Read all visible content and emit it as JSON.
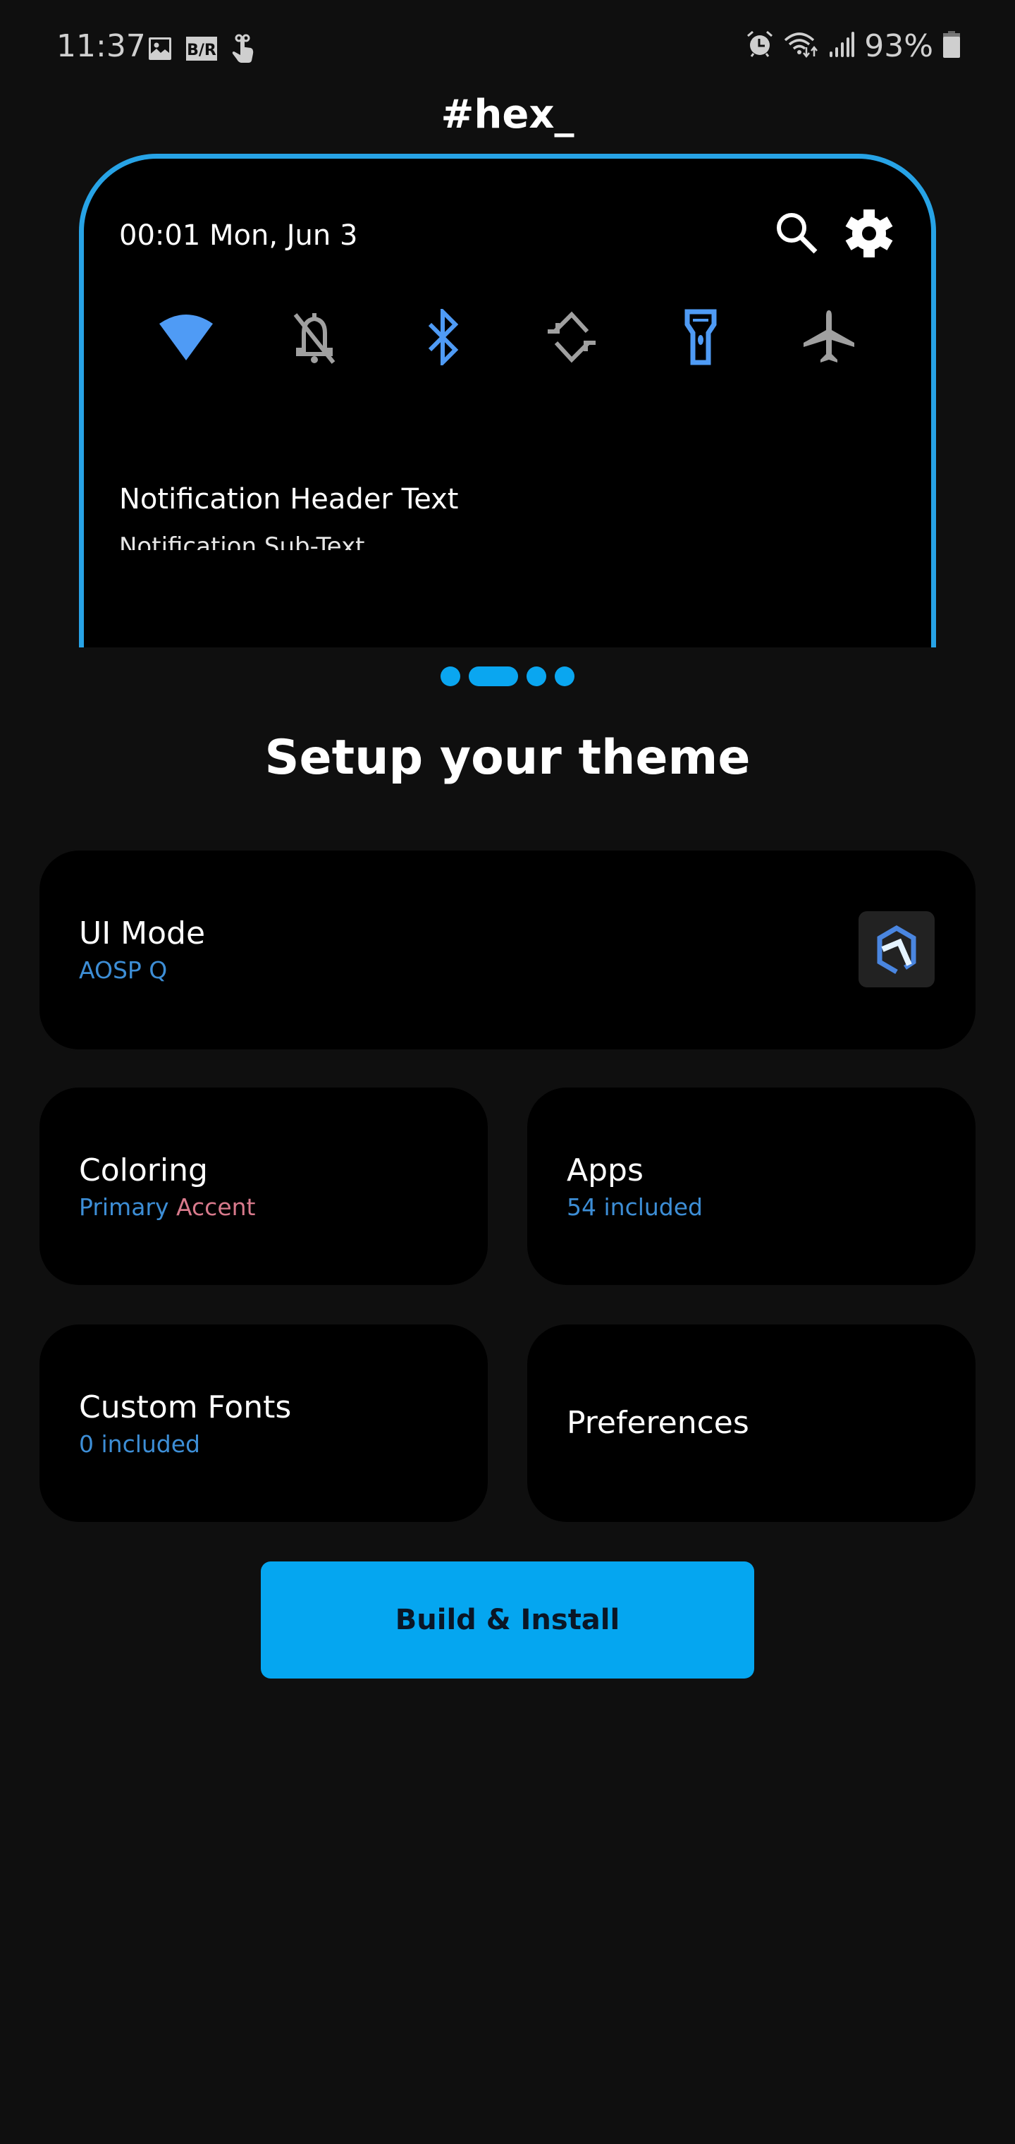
{
  "status_bar": {
    "time": "11:37",
    "left_icons": [
      "gallery-icon",
      "bleacher-report-icon",
      "touch-gesture-icon"
    ],
    "right_icons": [
      "alarm-icon",
      "wifi-data-icon",
      "cell-signal-icon",
      "battery-icon"
    ],
    "battery_percent": "93%",
    "br_label": "B/R"
  },
  "app": {
    "title": "#hex_"
  },
  "preview": {
    "datetime": "00:01 Mon, Jun 3",
    "actions": [
      "search-icon",
      "settings-icon"
    ],
    "quick_settings": [
      {
        "name": "wifi",
        "active": true
      },
      {
        "name": "do-not-disturb-off",
        "active": false
      },
      {
        "name": "bluetooth",
        "active": true
      },
      {
        "name": "auto-rotate",
        "active": false
      },
      {
        "name": "flashlight",
        "active": true
      },
      {
        "name": "airplane-mode",
        "active": false
      }
    ],
    "notification_header": "Notification Header Text",
    "notification_subtext": "Notification Sub-Text",
    "pager": {
      "count": 4,
      "active_index": 1
    }
  },
  "main": {
    "heading": "Setup your theme",
    "cards": {
      "ui_mode": {
        "title": "UI Mode",
        "subtitle": "AOSP Q"
      },
      "coloring": {
        "title": "Coloring",
        "subtitle_primary": "Primary",
        "subtitle_accent": "Accent"
      },
      "apps": {
        "title": "Apps",
        "subtitle": "54 included"
      },
      "fonts": {
        "title": "Custom Fonts",
        "subtitle": "0 included"
      },
      "preferences": {
        "title": "Preferences"
      }
    },
    "build_button": "Build & Install"
  },
  "colors": {
    "background": "#0f0f0f",
    "card": "#000000",
    "primary": "#0aa6f0",
    "preview_border": "#27a3e6",
    "subtitle_blue": "#3d8ed6",
    "accent_pink": "#d87a8c",
    "qs_active": "#4f9bf5",
    "qs_inactive": "#a0a0a0"
  }
}
